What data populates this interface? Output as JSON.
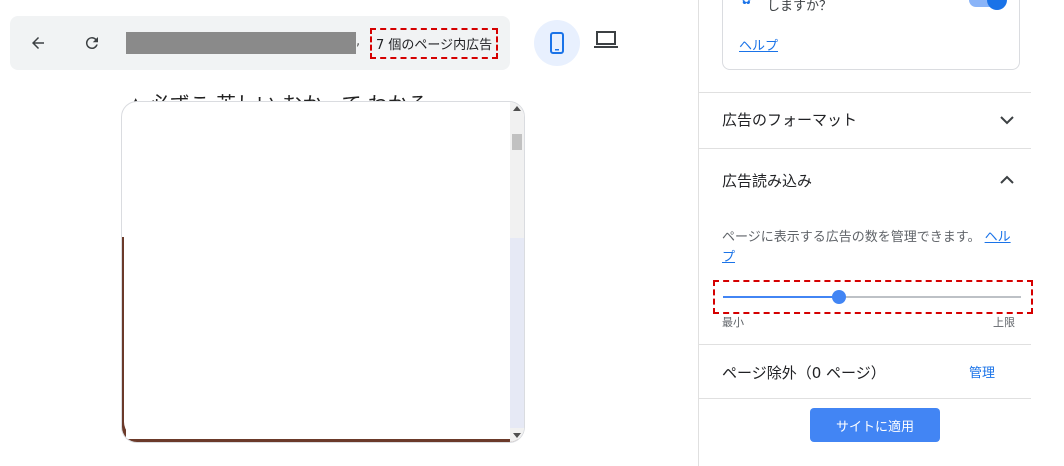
{
  "toolbar": {
    "back_icon": "arrow-left-icon",
    "reload_icon": "refresh-icon",
    "url_tail": ",",
    "ads_on_page": "7 個のページ内広告",
    "device_mobile_icon": "smartphone-icon",
    "device_laptop_icon": "laptop-icon"
  },
  "preview": {
    "top_text": "▲ 必ずこ 苦しい むかって わかる"
  },
  "panel": {
    "setting_text": "しますか？",
    "setting_help": "ヘルプ",
    "toggle_on": true,
    "sections": {
      "format_title": "広告のフォーマット",
      "load_title": "広告読み込み",
      "load_desc": "ページに表示する広告の数を管理できます。",
      "load_help": "ヘルプ",
      "slider_min": "最小",
      "slider_max": "上限",
      "slider_value_fraction": 0.39,
      "exclusions_title": "ページ除外（0 ページ）",
      "exclusions_manage": "管理"
    },
    "apply_button": "サイトに適用"
  },
  "colors": {
    "accent": "#1a73e8",
    "button_bg": "#4285f4",
    "highlight_dash": "#d50000"
  }
}
